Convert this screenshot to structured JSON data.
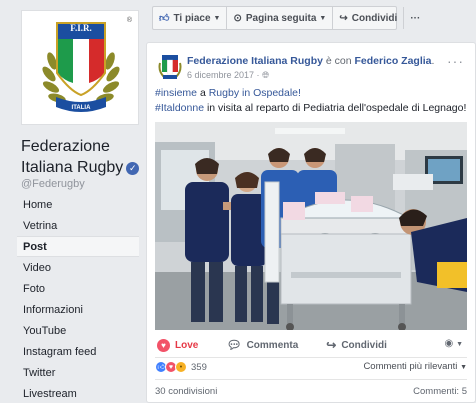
{
  "sidebar": {
    "logo_text": "F.I.R.",
    "logo_banner": "ITALIA",
    "page_name": "Federazione Italiana Rugby",
    "handle": "@Federugby",
    "nav_items": [
      {
        "label": "Home"
      },
      {
        "label": "Vetrina"
      },
      {
        "label": "Post",
        "active": true
      },
      {
        "label": "Video"
      },
      {
        "label": "Foto"
      },
      {
        "label": "Informazioni"
      },
      {
        "label": "YouTube"
      },
      {
        "label": "Instagram feed"
      },
      {
        "label": "Twitter"
      },
      {
        "label": "Livestream"
      }
    ]
  },
  "topbar": {
    "like_label": "Ti piace",
    "follow_label": "Pagina seguita",
    "share_label": "Condividi",
    "more_label": "···"
  },
  "post": {
    "author": "Federazione Italiana Rugby",
    "with_text": "è con",
    "tagged": "Federico Zaglia",
    "date": "6 dicembre 2017",
    "hashtag1": "#insieme",
    "text1_mid": "a",
    "text1_link": "Rugby in Ospedale!",
    "hashtag2": "#Italdonne",
    "text2": "in visita al reparto di Pediatria dell'ospedale di Legnago!",
    "more_label": "···"
  },
  "actions": {
    "love_label": "Love",
    "comment_label": "Commenta",
    "share_label": "Condividi"
  },
  "stats": {
    "reaction_count": "359",
    "sort_label": "Commenti più rilevanti",
    "shares": "30 condivisioni",
    "comments": "Commenti: 5"
  },
  "colors": {
    "link": "#365899",
    "accent": "#4267b2",
    "love": "#f25268",
    "team_navy": "#1b2a5a"
  }
}
